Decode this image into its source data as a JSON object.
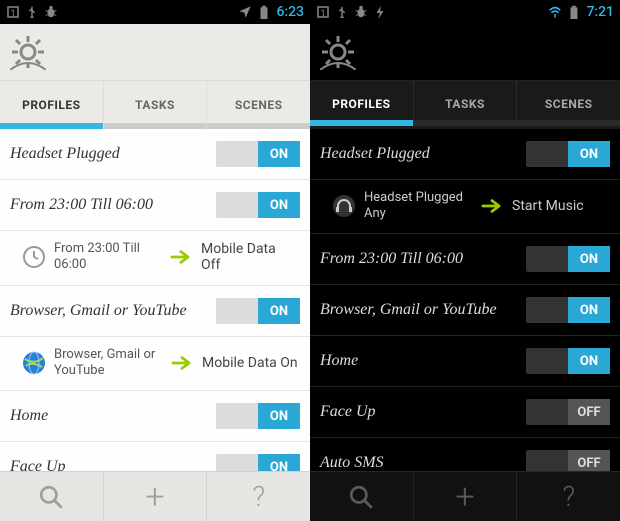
{
  "left": {
    "status": {
      "time": "6:23"
    },
    "tabs": {
      "profiles": "PROFILES",
      "tasks": "TASKS",
      "scenes": "SCENES",
      "active": "profiles"
    },
    "profiles": [
      {
        "name": "Headset Plugged",
        "state": "ON"
      },
      {
        "name": "From 23:00 Till 06:00",
        "state": "ON",
        "detail": {
          "condition": "From 23:00 Till 06:00",
          "action": "Mobile Data Off",
          "icon": "clock"
        }
      },
      {
        "name": "Browser, Gmail or YouTube",
        "state": "ON",
        "detail": {
          "condition": "Browser, Gmail or YouTube",
          "action": "Mobile Data On",
          "icon": "globe"
        }
      },
      {
        "name": "Home",
        "state": "ON"
      },
      {
        "name": "Face Up",
        "state": "ON"
      }
    ],
    "switch_labels": {
      "on": "ON",
      "off": "OFF"
    }
  },
  "right": {
    "status": {
      "time": "7:21"
    },
    "tabs": {
      "profiles": "PROFILES",
      "tasks": "TASKS",
      "scenes": "SCENES",
      "active": "profiles"
    },
    "profiles": [
      {
        "name": "Headset Plugged",
        "state": "ON",
        "detail": {
          "condition": "Headset Plugged Any",
          "action": "Start Music",
          "icon": "headset"
        }
      },
      {
        "name": "From 23:00 Till 06:00",
        "state": "ON"
      },
      {
        "name": "Browser, Gmail or YouTube",
        "state": "ON"
      },
      {
        "name": "Home",
        "state": "ON"
      },
      {
        "name": "Face Up",
        "state": "OFF"
      },
      {
        "name": "Auto SMS",
        "state": "OFF"
      }
    ],
    "switch_labels": {
      "on": "ON",
      "off": "OFF"
    }
  }
}
